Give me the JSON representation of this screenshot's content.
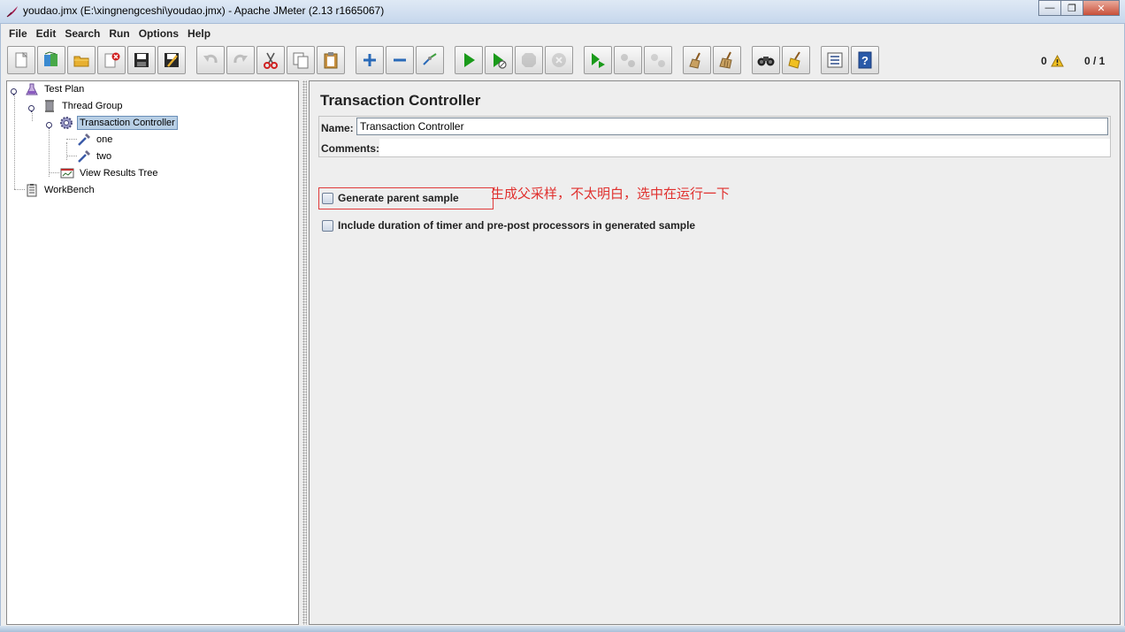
{
  "window": {
    "title": "youdao.jmx (E:\\xingnengceshi\\youdao.jmx) - Apache JMeter (2.13 r1665067)",
    "minimize": "—",
    "maximize": "❐",
    "close": "✕"
  },
  "menu": {
    "file": "File",
    "edit": "Edit",
    "search": "Search",
    "run": "Run",
    "options": "Options",
    "help": "Help"
  },
  "toolbar": {
    "warnings_count": "0",
    "threads": "0 / 1",
    "icons": [
      "new-icon",
      "templates-icon",
      "open-icon",
      "close-icon",
      "save-icon",
      "save-as-icon",
      "undo-icon",
      "redo-icon",
      "cut-icon",
      "copy-icon",
      "paste-icon",
      "expand-icon",
      "collapse-icon",
      "toggle-icon",
      "start-icon",
      "start-no-pause-icon",
      "stop-icon",
      "shutdown-icon",
      "remote-start-icon",
      "remote-stop-icon",
      "remote-shutdown-icon",
      "clear-icon",
      "clear-all-icon",
      "search-icon",
      "reset-search-icon",
      "function-helper-icon",
      "help-icon"
    ]
  },
  "tree": {
    "test_plan": "Test Plan",
    "thread_group": "Thread Group",
    "transaction_controller": "Transaction Controller",
    "sampler_one": "one",
    "sampler_two": "two",
    "view_results_tree": "View Results Tree",
    "workbench": "WorkBench"
  },
  "panel": {
    "title": "Transaction Controller",
    "name_label": "Name:",
    "name_value": "Transaction Controller",
    "comments_label": "Comments:",
    "comments_value": "",
    "generate_parent_sample": "Generate parent sample",
    "generate_parent_checked": false,
    "include_duration": "Include duration of timer and pre-post processors in generated sample",
    "include_duration_checked": false,
    "annotation": "生成父采样，不太明白，选中在运行一下"
  },
  "colors": {
    "annotation": "#e0302e",
    "selection": "#b8cfe5",
    "start_green": "#1a9a1a"
  }
}
